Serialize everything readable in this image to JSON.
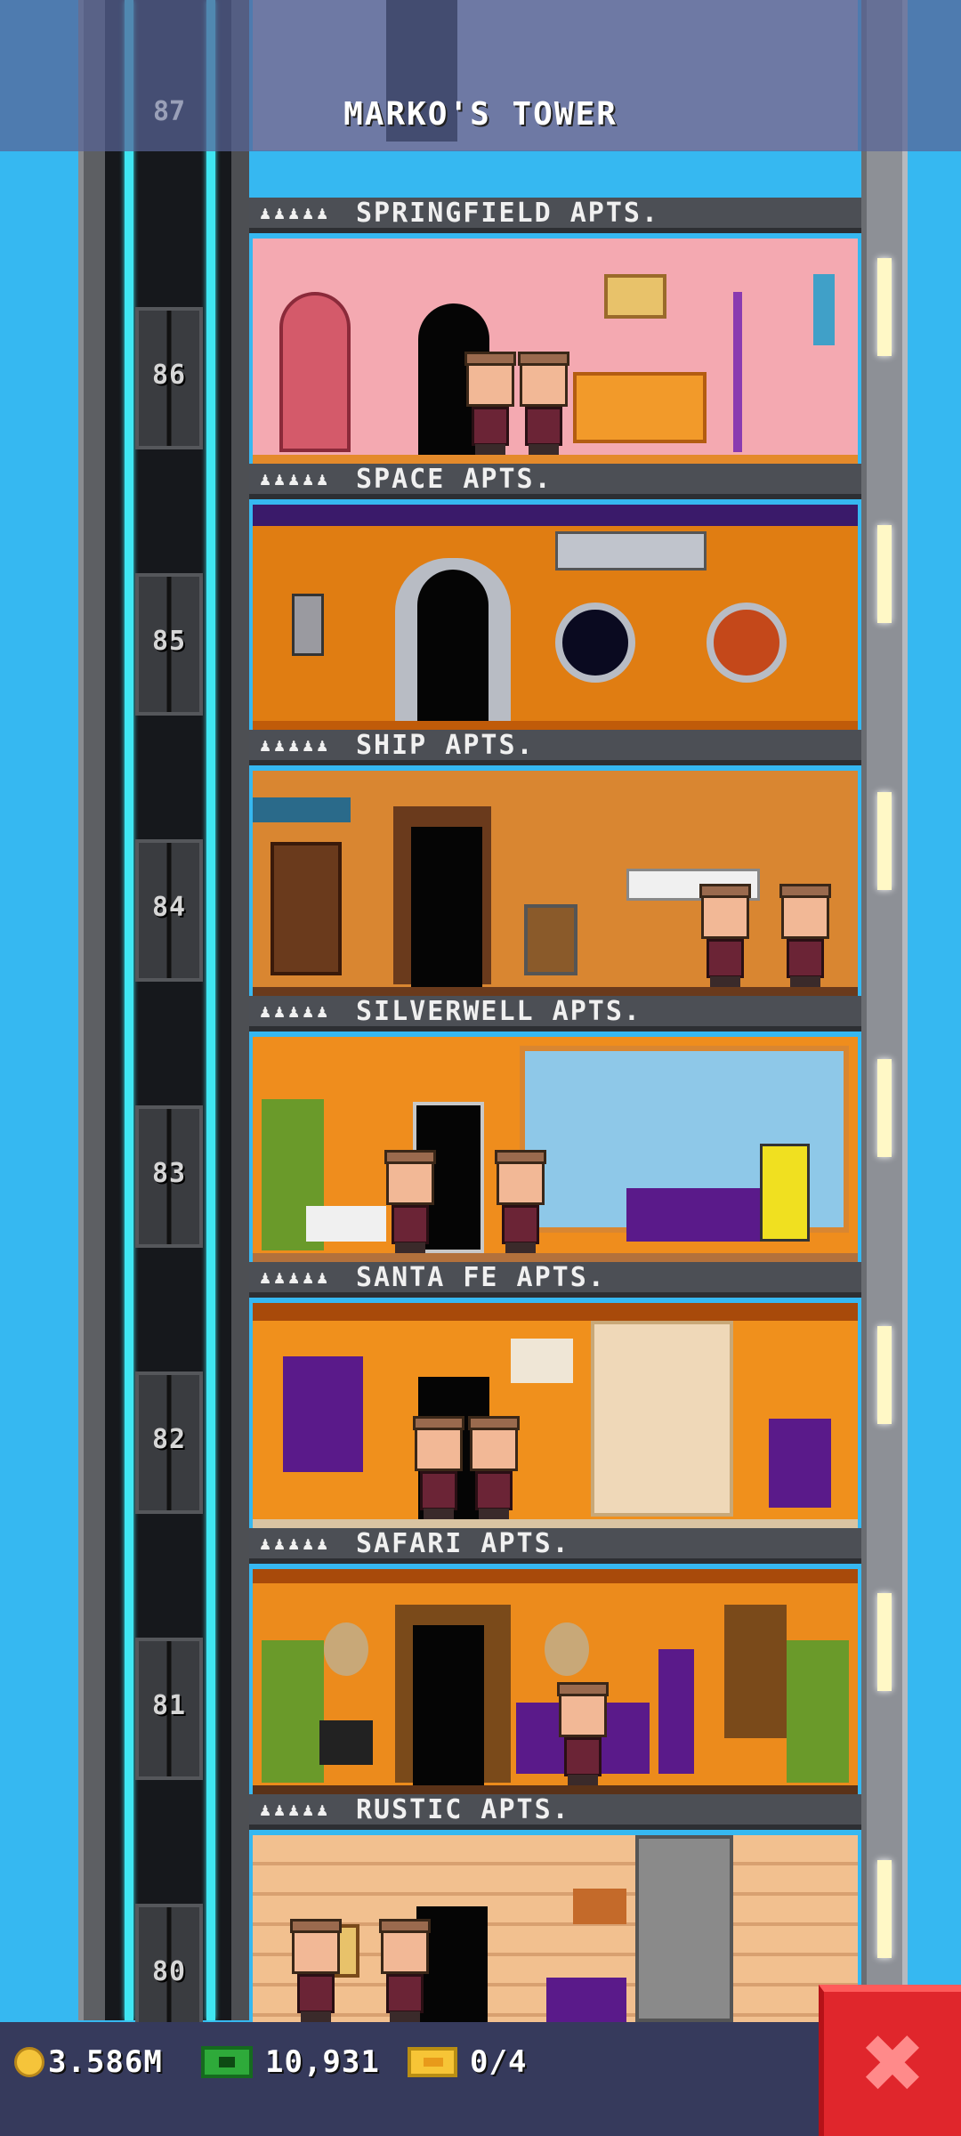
{
  "tower": {
    "title": "MARKO'S TOWER"
  },
  "top_floor": {
    "number": "87"
  },
  "floors": [
    {
      "number": "86",
      "name": "SPRINGFIELD APTS.",
      "wall_color": "#f4a9b1",
      "floor_color": "#e48a2b"
    },
    {
      "number": "85",
      "name": "SPACE APTS.",
      "wall_color": "#e07d12",
      "floor_color": "#c05b09"
    },
    {
      "number": "84",
      "name": "SHIP APTS.",
      "wall_color": "#d98631",
      "floor_color": "#6a3a1c"
    },
    {
      "number": "83",
      "name": "SILVERWELL APTS.",
      "wall_color": "#ef8d1d",
      "floor_color": "#b3713c"
    },
    {
      "number": "82",
      "name": "SANTA FE APTS.",
      "wall_color": "#f0901c",
      "floor_color": "#d9c4a2"
    },
    {
      "number": "81",
      "name": "SAFARI APTS.",
      "wall_color": "#ec8b1c",
      "floor_color": "#5a3218"
    },
    {
      "number": "80",
      "name": "RUSTIC APTS.",
      "wall_color": "#f2c08f",
      "floor_color": "#8a5a33"
    }
  ],
  "status": {
    "coins": "3.586M",
    "bux": "10,931",
    "tickets": "0/4"
  },
  "icons": {
    "coin": "coin-icon",
    "bux": "tower-bux-icon",
    "ticket": "golden-ticket-icon",
    "close": "close-icon"
  },
  "close_label": "✖"
}
